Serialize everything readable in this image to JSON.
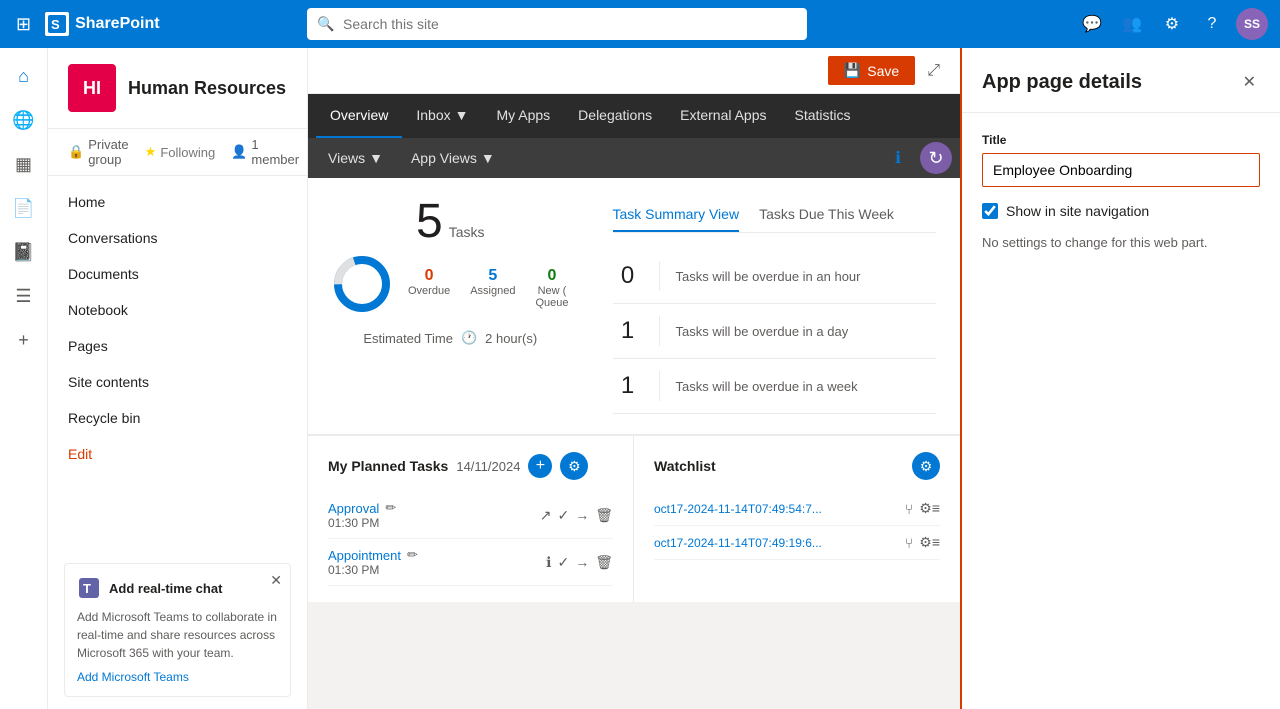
{
  "topbar": {
    "app_name": "SharePoint",
    "search_placeholder": "Search this site",
    "avatar_label": "SS"
  },
  "site": {
    "icon_initials": "HI",
    "title": "Human Resources",
    "private_group": "Private group",
    "following": "Following",
    "members": "1 member"
  },
  "sidebar": {
    "nav_items": [
      {
        "label": "Home"
      },
      {
        "label": "Conversations"
      },
      {
        "label": "Documents"
      },
      {
        "label": "Notebook"
      },
      {
        "label": "Pages"
      },
      {
        "label": "Site contents"
      },
      {
        "label": "Recycle bin"
      }
    ],
    "edit_label": "Edit",
    "notification": {
      "title": "Add real-time chat",
      "body": "Add Microsoft Teams to collaborate in real-time and share resources across Microsoft 365 with your team.",
      "info_text": "ⓘ",
      "link_label": "Add Microsoft Teams"
    }
  },
  "page_toolbar": {
    "save_label": "Save",
    "expand_icon": "⤢"
  },
  "app_nav": {
    "items": [
      {
        "label": "Overview",
        "active": true
      },
      {
        "label": "Inbox",
        "has_dropdown": true
      },
      {
        "label": "My Apps"
      },
      {
        "label": "Delegations"
      },
      {
        "label": "External Apps"
      },
      {
        "label": "Statistics"
      }
    ]
  },
  "sub_nav": {
    "items": [
      {
        "label": "Views",
        "has_dropdown": true
      },
      {
        "label": "App Views",
        "has_dropdown": true
      }
    ]
  },
  "task_summary": {
    "count": "5",
    "count_label": "Tasks",
    "overdue_num": "0",
    "overdue_label": "Overdue",
    "assigned_num": "5",
    "assigned_label": "Assigned",
    "new_queue_num": "0",
    "new_queue_label": "New (",
    "new_queue_label2": "Queue",
    "estimated_label": "Estimated Time",
    "estimated_value": "2 hour(s)",
    "tabs": [
      {
        "label": "Task Summary View",
        "active": true
      },
      {
        "label": "Tasks Due This Week",
        "active": false
      }
    ],
    "rows": [
      {
        "num": "0",
        "desc": "Tasks will be overdue in an hour"
      },
      {
        "num": "1",
        "desc": "Tasks will be overdue in a day"
      },
      {
        "num": "1",
        "desc": "Tasks will be overdue in a week"
      }
    ]
  },
  "planned_tasks": {
    "title": "My Planned Tasks",
    "date": "14/11/2024",
    "items": [
      {
        "name": "Approval",
        "time": "01:30 PM"
      },
      {
        "name": "Appointment",
        "time": "01:30 PM"
      }
    ]
  },
  "watchlist": {
    "title": "Watchlist",
    "items": [
      {
        "link": "oct17-2024-11-14T07:49:54:7..."
      },
      {
        "link": "oct17-2024-11-14T07:49:19:6..."
      }
    ]
  },
  "right_panel": {
    "title": "App page details",
    "field_label": "Title",
    "field_value": "Employee Onboarding",
    "field_placeholder": "Employee Onboarding",
    "checkbox_label": "Show in site navigation",
    "no_settings_text": "No settings to change for this web part."
  }
}
